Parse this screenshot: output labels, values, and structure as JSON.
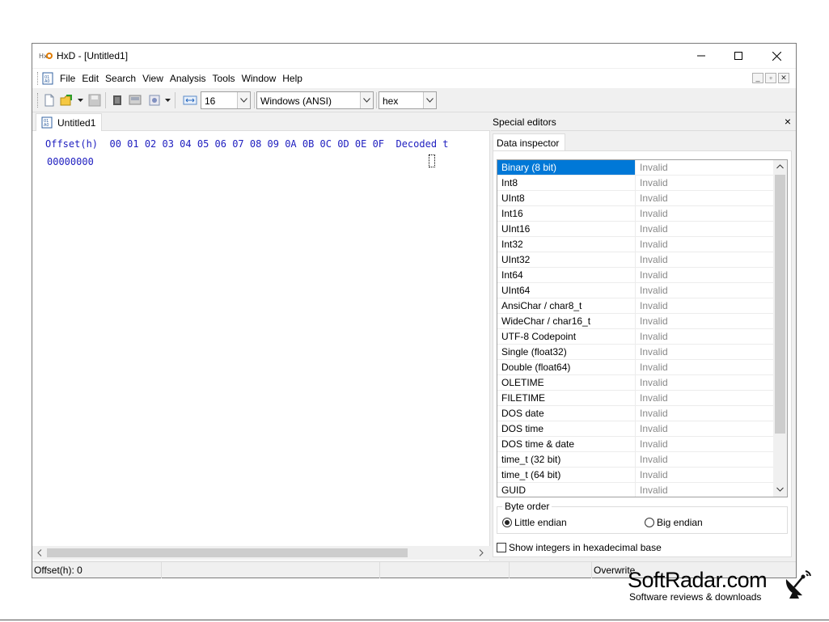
{
  "window": {
    "title": "HxD - [Untitled1]",
    "app_icon": "hxd-app-icon",
    "controls": [
      "minimize-icon",
      "maximize-icon",
      "close-icon"
    ]
  },
  "menu": {
    "items": [
      "File",
      "Edit",
      "Search",
      "View",
      "Analysis",
      "Tools",
      "Window",
      "Help"
    ],
    "mdi_buttons": [
      "_",
      "▫",
      "✕"
    ]
  },
  "toolbar": {
    "bytes_per_row": "16",
    "charset": "Windows (ANSI)",
    "offset_base": "hex",
    "icons": [
      "new-file-icon",
      "open-file-icon",
      "save-icon",
      "ram-icon",
      "disk-icon",
      "image-icon",
      "columns-icon"
    ]
  },
  "editor": {
    "tab": "Untitled1",
    "header": "Offset(h)  00 01 02 03 04 05 06 07 08 09 0A 0B 0C 0D 0E 0F  Decoded t",
    "first_offset": "00000000"
  },
  "special_editors": {
    "title": "Special editors",
    "close": "×",
    "tab": "Data inspector",
    "rows": [
      {
        "name": "Binary (8 bit)",
        "value": "Invalid"
      },
      {
        "name": "Int8",
        "value": "Invalid"
      },
      {
        "name": "UInt8",
        "value": "Invalid"
      },
      {
        "name": "Int16",
        "value": "Invalid"
      },
      {
        "name": "UInt16",
        "value": "Invalid"
      },
      {
        "name": "Int32",
        "value": "Invalid"
      },
      {
        "name": "UInt32",
        "value": "Invalid"
      },
      {
        "name": "Int64",
        "value": "Invalid"
      },
      {
        "name": "UInt64",
        "value": "Invalid"
      },
      {
        "name": "AnsiChar / char8_t",
        "value": "Invalid"
      },
      {
        "name": "WideChar / char16_t",
        "value": "Invalid"
      },
      {
        "name": "UTF-8 Codepoint",
        "value": "Invalid"
      },
      {
        "name": "Single (float32)",
        "value": "Invalid"
      },
      {
        "name": "Double (float64)",
        "value": "Invalid"
      },
      {
        "name": "OLETIME",
        "value": "Invalid"
      },
      {
        "name": "FILETIME",
        "value": "Invalid"
      },
      {
        "name": "DOS date",
        "value": "Invalid"
      },
      {
        "name": "DOS time",
        "value": "Invalid"
      },
      {
        "name": "DOS time & date",
        "value": "Invalid"
      },
      {
        "name": "time_t (32 bit)",
        "value": "Invalid"
      },
      {
        "name": "time_t (64 bit)",
        "value": "Invalid"
      },
      {
        "name": "GUID",
        "value": "Invalid"
      }
    ],
    "byte_order": {
      "label": "Byte order",
      "little": "Little endian",
      "big": "Big endian",
      "selected": "little"
    },
    "hex_checkbox": "Show integers in hexadecimal base"
  },
  "status": {
    "offset": "Offset(h): 0",
    "mode": "Overwrite"
  },
  "watermark": {
    "logo": "SoftRadar.com",
    "tagline": "Software reviews & downloads",
    "icon": "satellite-dish-icon"
  },
  "colors": {
    "selection": "#0078d7",
    "hex_text": "#2020c0",
    "invalid_text": "#8a8a8a"
  }
}
